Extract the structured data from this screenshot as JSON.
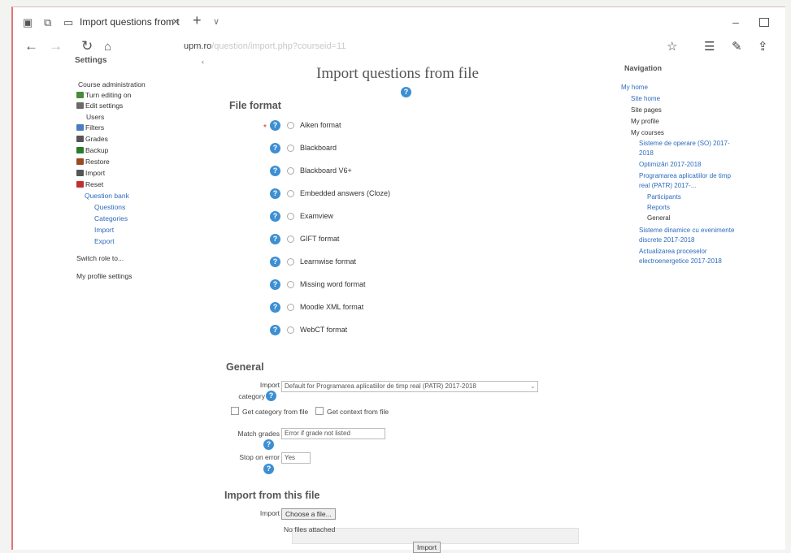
{
  "browser": {
    "tab_title": "Import questions from t",
    "tab_close": "×",
    "tab_new": "+",
    "tab_more": "∨",
    "win_min": "–",
    "url_host": "upm.ro",
    "url_rest": "/question/import.php?courseid=11"
  },
  "settings": {
    "title": "Settings",
    "collapse": "‹",
    "items": [
      {
        "label": "Course administration",
        "color": ""
      },
      {
        "label": "Turn editing on",
        "color": "#4a8a3a"
      },
      {
        "label": "Edit settings",
        "color": "#6a6a6a"
      },
      {
        "label": "Users",
        "color": ""
      },
      {
        "label": "Filters",
        "color": "#4a7dc0"
      },
      {
        "label": "Grades",
        "color": "#555"
      },
      {
        "label": "Backup",
        "color": "#2a7a2a"
      },
      {
        "label": "Restore",
        "color": "#9a4a20"
      },
      {
        "label": "Import",
        "color": "#555"
      },
      {
        "label": "Reset",
        "color": "#c03030"
      },
      {
        "label": "Question bank",
        "color": ""
      },
      {
        "label": "Questions",
        "color": ""
      },
      {
        "label": "Categories",
        "color": ""
      },
      {
        "label": "Import",
        "color": ""
      },
      {
        "label": "Export",
        "color": ""
      },
      {
        "label": "Switch role to...",
        "color": ""
      },
      {
        "label": "My profile settings",
        "color": ""
      }
    ]
  },
  "main": {
    "title": "Import questions from file",
    "file_format": {
      "heading": "File format",
      "required_mark": "*",
      "options": [
        "Aiken format",
        "Blackboard",
        "Blackboard V6+",
        "Embedded answers (Cloze)",
        "Examview",
        "GIFT format",
        "Learnwise format",
        "Missing word format",
        "Moodle XML format",
        "WebCT format"
      ]
    },
    "general": {
      "heading": "General",
      "import_category_label1": "Import",
      "import_category_label2": "category",
      "import_category_value": "Default for Programarea aplicatiilor de timp real (PATR) 2017-2018",
      "get_category": "Get category from file",
      "get_context": "Get context from file",
      "match_grades_label": "Match grades",
      "match_grades_value": "Error if grade not listed",
      "stop_on_error_label": "Stop on error",
      "stop_on_error_value": "Yes"
    },
    "import_file": {
      "heading": "Import from this file",
      "import_label": "Import",
      "choose_button": "Choose a file...",
      "no_files": "No files attached",
      "submit": "Import"
    }
  },
  "navigation": {
    "title": "Navigation",
    "items": [
      "My home",
      "Site home",
      "Site pages",
      "My profile",
      "My courses",
      "Sisteme de operare (SO) 2017-",
      "2018",
      "Optimizări 2017-2018",
      "Programarea aplicatiilor de timp",
      "real (PATR) 2017-...",
      "Participants",
      "Reports",
      "General",
      "Sisteme dinamice cu evenimente",
      "discrete 2017-2018",
      "Actualizarea proceselor",
      "electroenergetice 2017-2018"
    ]
  }
}
